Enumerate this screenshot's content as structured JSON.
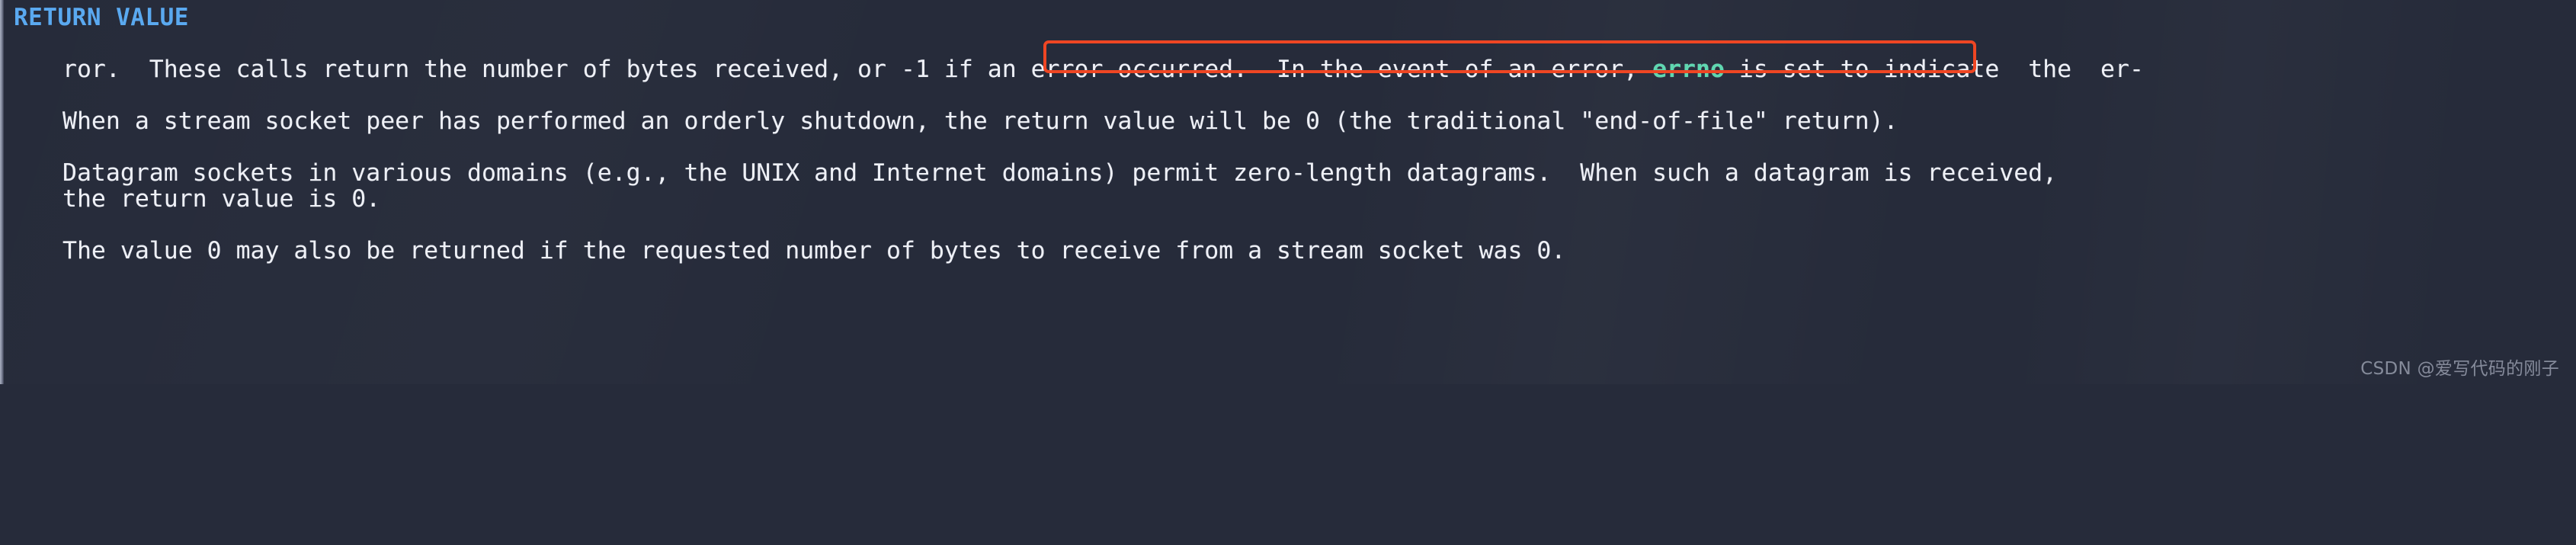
{
  "window": {
    "background_color": "#262b3a",
    "foreground_color": "#eef0f6",
    "heading_color": "#5aa9f0",
    "accent_color": "#5fd7b0",
    "annotation_color": "#ef4623"
  },
  "manpage": {
    "section_heading": "RETURN VALUE",
    "paragraphs": [
      {
        "id": "para-return-bytes",
        "lines": [
          {
            "id": "line-1",
            "segments": [
              {
                "text": "These calls return the number of bytes received, or -1 if an error occurred.  In the event of an error, ",
                "style": "normal"
              },
              {
                "text": "errno",
                "style": "accent"
              },
              {
                "text": " is set to indicate  the  er-",
                "style": "normal"
              }
            ]
          },
          {
            "id": "line-2",
            "segments": [
              {
                "text": "ror.",
                "style": "normal"
              }
            ]
          }
        ]
      },
      {
        "id": "para-stream-shutdown",
        "lines": [
          {
            "id": "line-3",
            "segments": [
              {
                "text": "When a stream socket peer has performed an orderly shutdown, the return value will be 0 (the traditional \"end-of-file\" return).",
                "style": "normal"
              }
            ]
          }
        ]
      },
      {
        "id": "para-datagram",
        "lines": [
          {
            "id": "line-4",
            "segments": [
              {
                "text": "Datagram sockets in various domains (e.g., the UNIX and Internet domains) permit zero-length datagrams.  When such a datagram is received,",
                "style": "normal"
              }
            ]
          },
          {
            "id": "line-5",
            "segments": [
              {
                "text": "the return value is 0.",
                "style": "normal"
              }
            ]
          }
        ]
      },
      {
        "id": "para-zero-request",
        "lines": [
          {
            "id": "line-6",
            "segments": [
              {
                "text": "The value 0 may also be returned if the requested number of bytes to receive from a stream socket was 0.",
                "style": "normal"
              }
            ]
          }
        ]
      }
    ],
    "highlighted_phrase": "-1 if an error occurred.  In the event of an error, errno is set"
  },
  "watermark": {
    "text": "CSDN @爱写代码的刚子"
  }
}
